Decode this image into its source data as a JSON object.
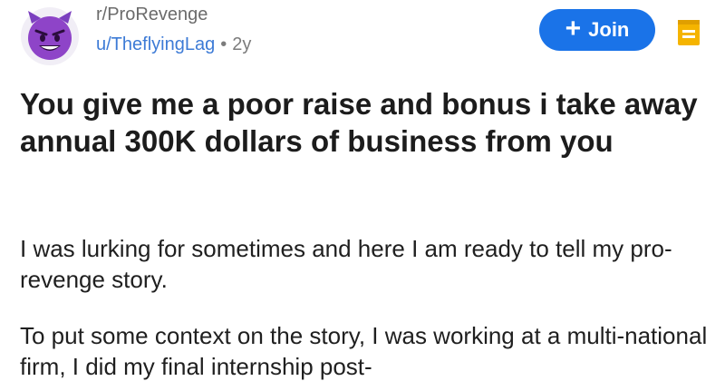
{
  "header": {
    "subreddit": "r/ProRevenge",
    "username": "u/TheflyingLag",
    "separator": "•",
    "age": "2y",
    "avatar_icon": "devil-emoji-icon",
    "join_icon": "plus-icon",
    "join_label": "Join",
    "save_icon": "bookmark-icon"
  },
  "post": {
    "title": "You give me a poor raise and bonus i take away annual 300K dollars of business from you",
    "paragraphs": [
      "I was lurking for sometimes and here I am ready to tell my pro-revenge story.",
      "To put some context on the story, I was working at a multi-national firm, I did my final internship post-"
    ]
  },
  "colors": {
    "accent": "#1a73e8",
    "username": "#3d7bd6",
    "avatar": "#7b3fbf",
    "bookmark": "#f5b400"
  }
}
